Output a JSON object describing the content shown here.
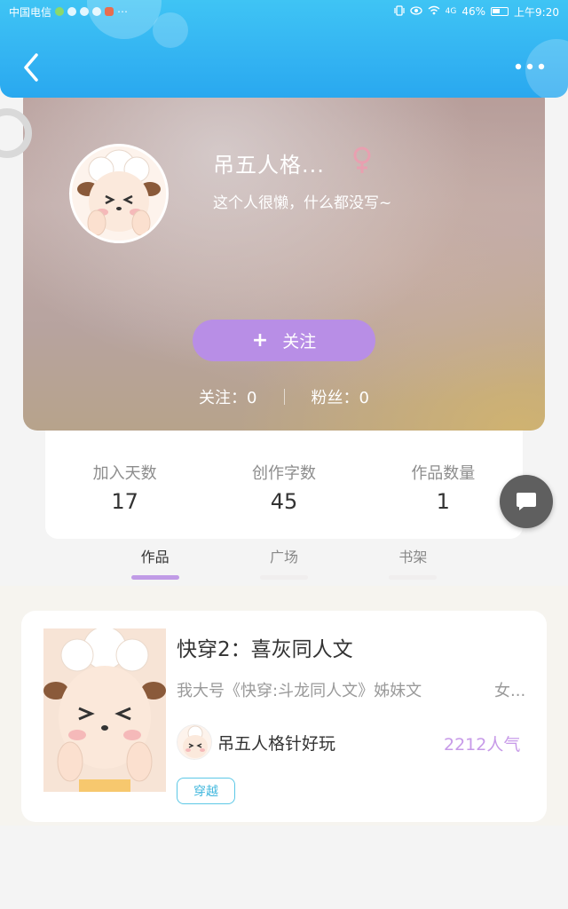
{
  "status_bar": {
    "carrier": "中国电信",
    "extra_icons": "⋯",
    "signal_text": "4G",
    "battery": "46%",
    "time": "上午9:20"
  },
  "nav": {
    "back_icon": "chevron-left-icon",
    "more_icon": "more-dots-icon"
  },
  "profile": {
    "name": "吊五人格...",
    "gender": "female",
    "gender_symbol": "♀",
    "bio": "这个人很懒，什么都没写~",
    "follow_button": "关注",
    "follow_plus": "+",
    "following_label": "关注：",
    "following_count": "0",
    "fans_label": "粉丝：",
    "fans_count": "0"
  },
  "stats": [
    {
      "label": "加入天数",
      "value": "17"
    },
    {
      "label": "创作字数",
      "value": "45"
    },
    {
      "label": "作品数量",
      "value": "1"
    }
  ],
  "tabs": [
    {
      "label": "作品",
      "active": true
    },
    {
      "label": "广场",
      "active": false
    },
    {
      "label": "书架",
      "active": false
    }
  ],
  "work": {
    "title": "快穿2：喜灰同人文",
    "description": "我大号《快穿:斗龙同人文》姊妹文",
    "category": "女...",
    "author": "吊五人格针好玩",
    "popularity": "2212人气",
    "tag": "穿越"
  },
  "colors": {
    "header": "#33b3f2",
    "follow_button": "#b88ee6",
    "tab_active": "#c09be6",
    "popularity": "#c79ae8",
    "tag": "#43b8de",
    "gender": "#e8a0b0"
  }
}
